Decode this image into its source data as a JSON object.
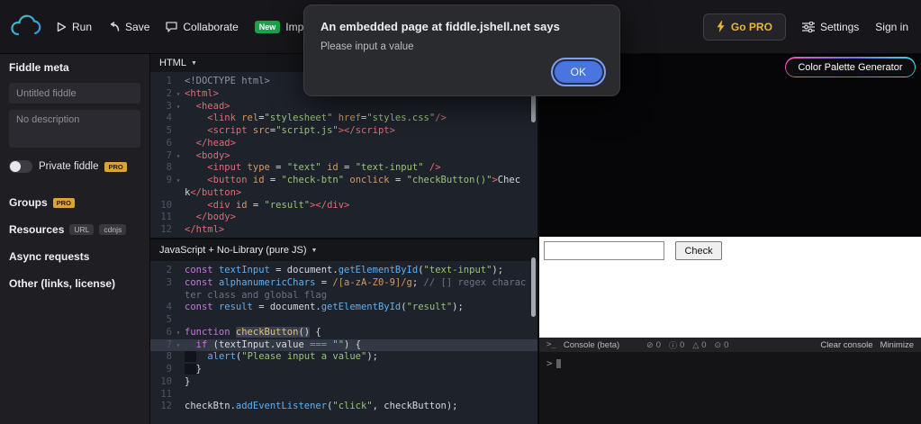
{
  "topbar": {
    "run": "Run",
    "save": "Save",
    "collaborate": "Collaborate",
    "new_badge": "New",
    "import_item": "Import",
    "go_pro": "Go PRO",
    "settings": "Settings",
    "sign_in": "Sign in"
  },
  "sidebar": {
    "heading": "Fiddle meta",
    "title_placeholder": "Untitled fiddle",
    "description_placeholder": "No description",
    "private_fiddle": "Private fiddle",
    "pro_badge": "PRO",
    "groups": "Groups",
    "resources": "Resources",
    "resource_url_badge": "URL",
    "resource_cdnjs_badge": "cdnjs",
    "async_requests": "Async requests",
    "other": "Other (links, license)"
  },
  "html_panel": {
    "title": "HTML",
    "lines": [
      {
        "n": "1",
        "tokens": [
          {
            "t": "meta",
            "s": "<!DOCTYPE html>"
          }
        ]
      },
      {
        "n": "2",
        "fold": true,
        "tokens": [
          {
            "t": "tag",
            "s": "<html>"
          }
        ]
      },
      {
        "n": "3",
        "fold": true,
        "tokens": [
          {
            "t": "pl",
            "s": "  "
          },
          {
            "t": "tag",
            "s": "<head>"
          }
        ]
      },
      {
        "n": "4",
        "tokens": [
          {
            "t": "pl",
            "s": "    "
          },
          {
            "t": "tag",
            "s": "<link"
          },
          {
            "t": "attr",
            "s": " rel"
          },
          {
            "t": "pl",
            "s": "="
          },
          {
            "t": "str",
            "s": "\"stylesheet\""
          },
          {
            "t": "attr",
            "s": " href"
          },
          {
            "t": "pl",
            "s": "="
          },
          {
            "t": "str",
            "s": "\"styles.css\""
          },
          {
            "t": "tag",
            "s": "/>"
          }
        ]
      },
      {
        "n": "5",
        "tokens": [
          {
            "t": "pl",
            "s": "    "
          },
          {
            "t": "tag",
            "s": "<script"
          },
          {
            "t": "attr",
            "s": " src"
          },
          {
            "t": "pl",
            "s": "="
          },
          {
            "t": "str",
            "s": "\"script.js\""
          },
          {
            "t": "tag",
            "s": "></script>"
          }
        ]
      },
      {
        "n": "6",
        "tokens": [
          {
            "t": "pl",
            "s": "  "
          },
          {
            "t": "tag",
            "s": "</head>"
          }
        ]
      },
      {
        "n": "7",
        "fold": true,
        "tokens": [
          {
            "t": "pl",
            "s": "  "
          },
          {
            "t": "tag",
            "s": "<body>"
          }
        ]
      },
      {
        "n": "8",
        "tokens": [
          {
            "t": "pl",
            "s": "    "
          },
          {
            "t": "tag",
            "s": "<input"
          },
          {
            "t": "attr",
            "s": " type"
          },
          {
            "t": "pl",
            "s": " = "
          },
          {
            "t": "str",
            "s": "\"text\""
          },
          {
            "t": "attr",
            "s": " id"
          },
          {
            "t": "pl",
            "s": " = "
          },
          {
            "t": "str",
            "s": "\"text-input\""
          },
          {
            "t": "tag",
            "s": " />"
          }
        ]
      },
      {
        "n": "9",
        "fold": true,
        "tokens": [
          {
            "t": "pl",
            "s": "    "
          },
          {
            "t": "tag",
            "s": "<button"
          },
          {
            "t": "attr",
            "s": " id"
          },
          {
            "t": "pl",
            "s": " = "
          },
          {
            "t": "str",
            "s": "\"check-btn\""
          },
          {
            "t": "attr",
            "s": " onclick"
          },
          {
            "t": "pl",
            "s": " = "
          },
          {
            "t": "str",
            "s": "\"checkButton()\""
          },
          {
            "t": "tag",
            "s": ">"
          },
          {
            "t": "pl",
            "s": "Chec"
          }
        ]
      },
      {
        "n": "",
        "tokens": [
          {
            "t": "pl",
            "s": "k"
          },
          {
            "t": "tag",
            "s": "</button>"
          }
        ]
      },
      {
        "n": "10",
        "tokens": [
          {
            "t": "pl",
            "s": "    "
          },
          {
            "t": "tag",
            "s": "<div"
          },
          {
            "t": "attr",
            "s": " id"
          },
          {
            "t": "pl",
            "s": " = "
          },
          {
            "t": "str",
            "s": "\"result\""
          },
          {
            "t": "tag",
            "s": "></div>"
          }
        ]
      },
      {
        "n": "11",
        "tokens": [
          {
            "t": "pl",
            "s": "  "
          },
          {
            "t": "tag",
            "s": "</body>"
          }
        ]
      },
      {
        "n": "12",
        "tokens": [
          {
            "t": "tag",
            "s": "</html>"
          }
        ]
      }
    ]
  },
  "js_panel": {
    "title": "JavaScript + No-Library (pure JS)",
    "lines": [
      {
        "n": "2",
        "tokens": [
          {
            "t": "kw",
            "s": "const "
          },
          {
            "t": "fn",
            "s": "textInput"
          },
          {
            "t": "pl",
            "s": " = document."
          },
          {
            "t": "fn",
            "s": "getElementById"
          },
          {
            "t": "pl",
            "s": "("
          },
          {
            "t": "str",
            "s": "\"text-input\""
          },
          {
            "t": "pl",
            "s": ");"
          }
        ]
      },
      {
        "n": "3",
        "tokens": [
          {
            "t": "kw",
            "s": "const "
          },
          {
            "t": "fn",
            "s": "alphanumericChars"
          },
          {
            "t": "pl",
            "s": " = "
          },
          {
            "t": "re",
            "s": "/[a-zA-Z0-9]/g"
          },
          {
            "t": "pl",
            "s": "; "
          },
          {
            "t": "cmt",
            "s": "// [] regex charac"
          }
        ]
      },
      {
        "n": "",
        "tokens": [
          {
            "t": "cmt",
            "s": "ter class and global flag"
          }
        ]
      },
      {
        "n": "4",
        "tokens": [
          {
            "t": "kw",
            "s": "const "
          },
          {
            "t": "fn",
            "s": "result"
          },
          {
            "t": "pl",
            "s": " = document."
          },
          {
            "t": "fn",
            "s": "getElementById"
          },
          {
            "t": "pl",
            "s": "("
          },
          {
            "t": "str",
            "s": "\"result\""
          },
          {
            "t": "pl",
            "s": ");"
          }
        ]
      },
      {
        "n": "5",
        "tokens": []
      },
      {
        "n": "6",
        "fold": true,
        "tokens": [
          {
            "t": "kw",
            "s": "function "
          },
          {
            "t": "def",
            "s": "checkButton",
            "b": true
          },
          {
            "t": "pl",
            "s": "()",
            "b": true
          },
          {
            "t": "pl",
            "s": " {"
          }
        ]
      },
      {
        "n": "7",
        "fold": true,
        "active": true,
        "tokens": [
          {
            "t": "pl",
            "s": "  "
          },
          {
            "t": "kw",
            "s": "if"
          },
          {
            "t": "pl",
            "s": " (textInput.value"
          },
          {
            "t": "op",
            "s": " === "
          },
          {
            "t": "str",
            "s": "\"\""
          },
          {
            "t": "pl",
            "s": ") {"
          }
        ]
      },
      {
        "n": "8",
        "tokens": [
          {
            "t": "dk",
            "s": "  "
          },
          {
            "t": "pl",
            "s": "  "
          },
          {
            "t": "fn",
            "s": "alert"
          },
          {
            "t": "pl",
            "s": "("
          },
          {
            "t": "str",
            "s": "\"Please input a value\""
          },
          {
            "t": "pl",
            "s": ");"
          }
        ]
      },
      {
        "n": "9",
        "tokens": [
          {
            "t": "dk",
            "s": "  "
          },
          {
            "t": "pl",
            "s": "}"
          }
        ]
      },
      {
        "n": "10",
        "tokens": [
          {
            "t": "pl",
            "s": "}"
          }
        ]
      },
      {
        "n": "11",
        "tokens": []
      },
      {
        "n": "12",
        "tokens": [
          {
            "t": "pl",
            "s": "checkBtn."
          },
          {
            "t": "fn",
            "s": "addEventListener"
          },
          {
            "t": "pl",
            "s": "("
          },
          {
            "t": "str",
            "s": "\"click\""
          },
          {
            "t": "pl",
            "s": ", checkButton);"
          }
        ]
      }
    ]
  },
  "css_panel": {
    "palette_button": "Color Palette Generator"
  },
  "result_panel": {
    "input_value": "",
    "check_button": "Check"
  },
  "console_panel": {
    "title": "Console (beta)",
    "counts": {
      "errors": "0",
      "infos": "0",
      "warnings": "0",
      "logs": "0"
    },
    "clear": "Clear console",
    "minimize": "Minimize",
    "prompt": ">"
  },
  "dialog": {
    "title": "An embedded page at fiddle.jshell.net says",
    "message": "Please input a value",
    "ok": "OK"
  },
  "colors": {
    "accent_teal": "#3db3b8",
    "pro_gold": "#d9a43b",
    "new_green": "#17a24b",
    "ok_blue": "#4a74e0",
    "palette_gradient_left": "#e85aad",
    "palette_gradient_right": "#3ad6e0"
  }
}
